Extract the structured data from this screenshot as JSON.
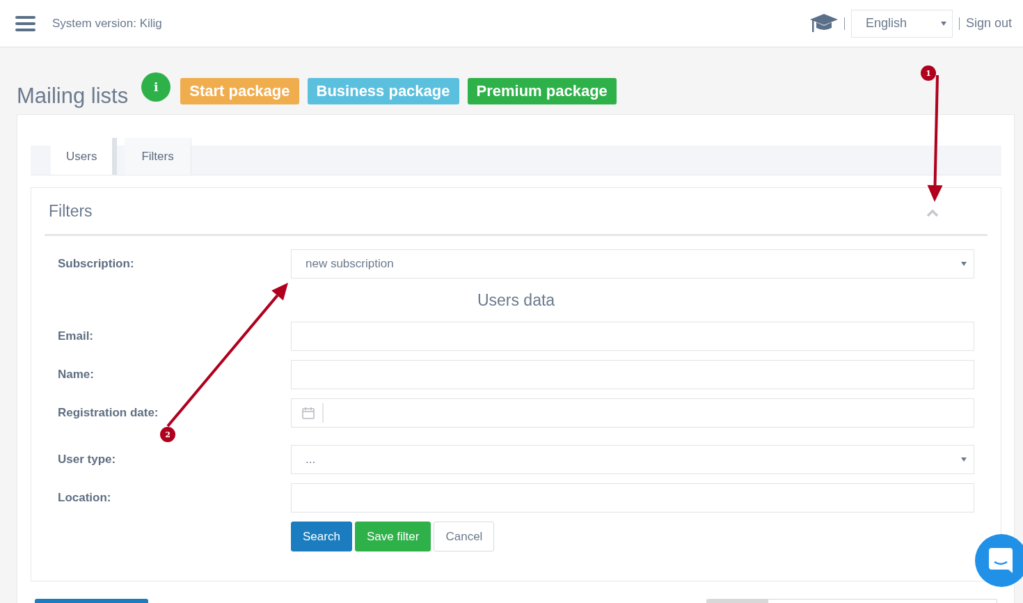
{
  "header": {
    "title": "System version: Kilig",
    "language": "English",
    "sign_out": "Sign out"
  },
  "page": {
    "title": "Mailing lists",
    "info_badge": "i",
    "packages": [
      {
        "label": "Start package",
        "color": "#f0ad4e"
      },
      {
        "label": "Business package",
        "color": "#5bc0de"
      },
      {
        "label": "Premium package",
        "color": "#2fb14a"
      }
    ]
  },
  "tabs": [
    {
      "label": "Users",
      "selected": true
    },
    {
      "label": "Filters",
      "selected": false
    }
  ],
  "filters": {
    "title": "Filters",
    "expanded": true,
    "fields": [
      {
        "kind": "select",
        "label": "Subscription:",
        "value": "new subscription"
      },
      {
        "kind": "heading",
        "label": "Users data"
      },
      {
        "kind": "text",
        "label": "Email:"
      },
      {
        "kind": "text",
        "label": "Name:"
      },
      {
        "kind": "date",
        "label": "Registration date:"
      },
      {
        "kind": "select",
        "label": "User type:",
        "value": "..."
      },
      {
        "kind": "text",
        "label": "Location:"
      }
    ],
    "buttons": [
      {
        "kind": "primary",
        "label": "Search"
      },
      {
        "kind": "success",
        "label": "Save filter"
      },
      {
        "kind": "default",
        "label": "Cancel"
      }
    ]
  },
  "annotations": [
    {
      "number": "1"
    },
    {
      "number": "2"
    }
  ]
}
